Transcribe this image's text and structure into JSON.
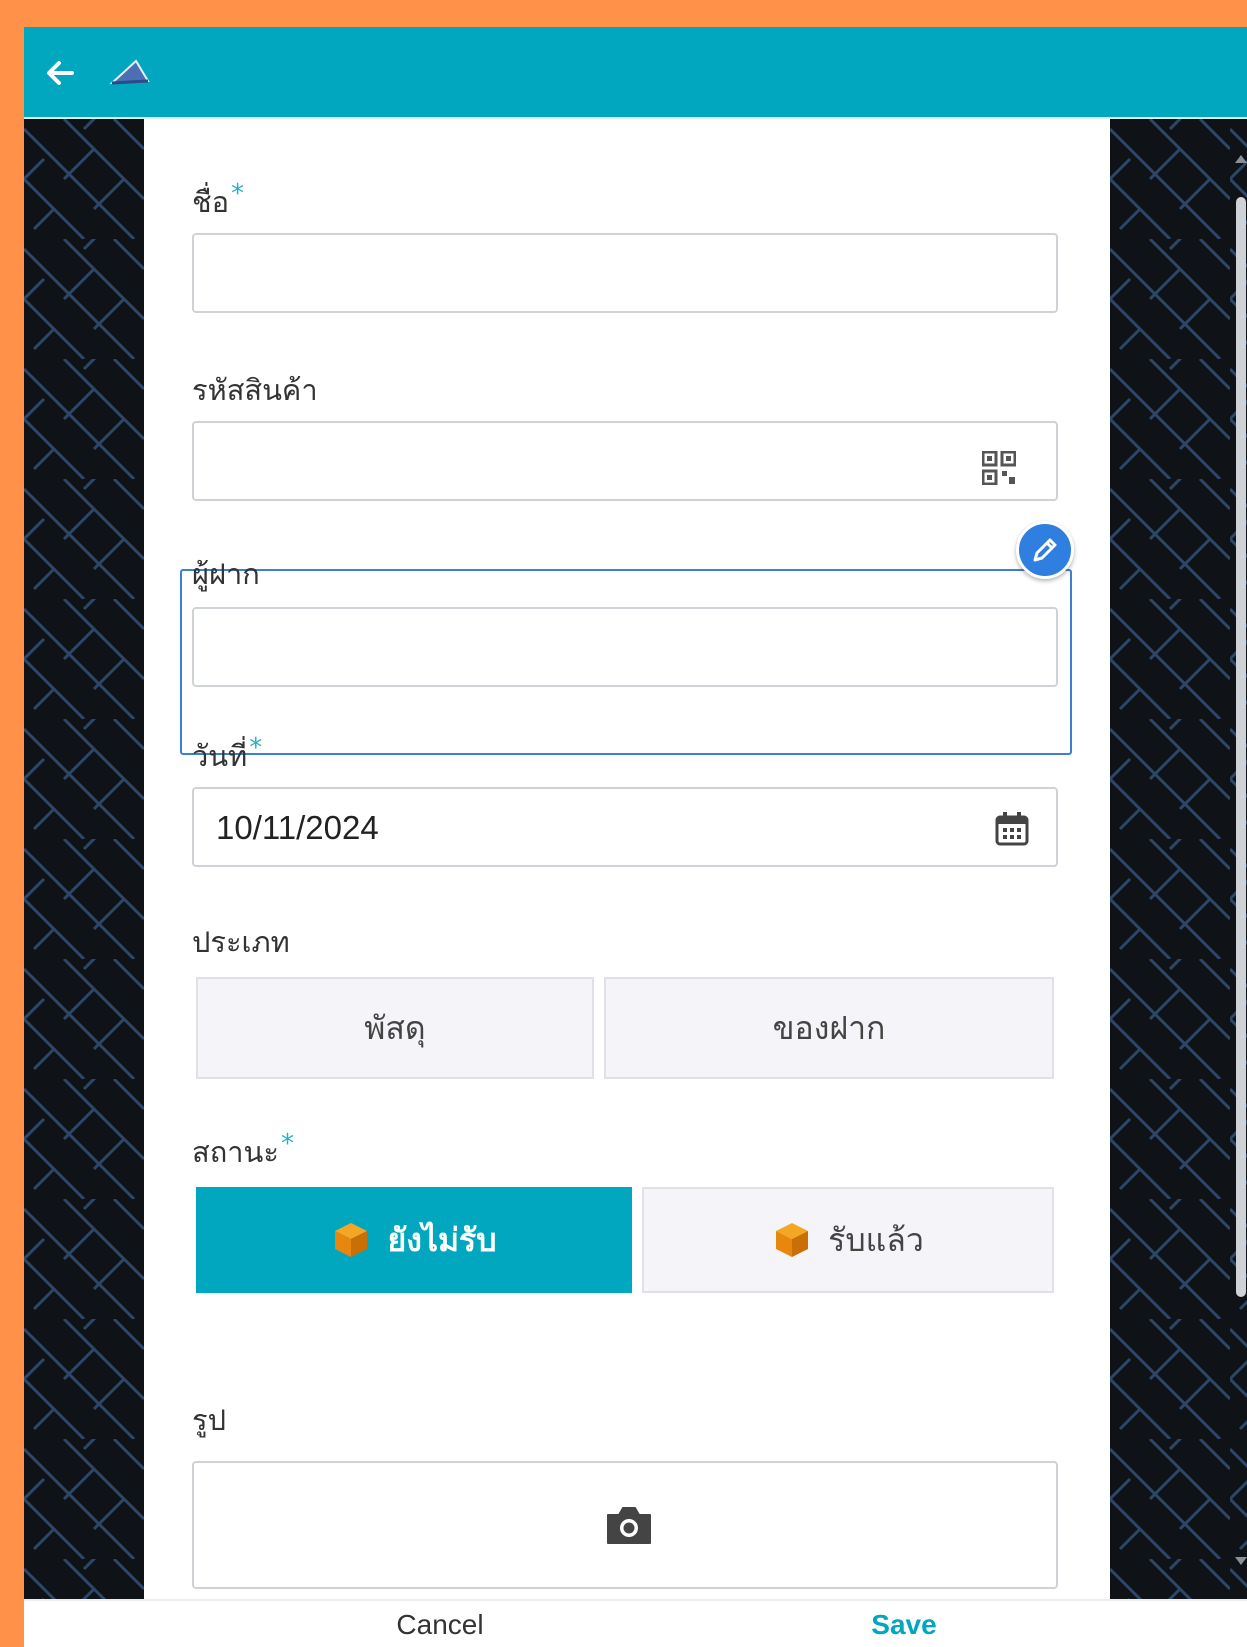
{
  "colors": {
    "brand": "#00A7BF",
    "background": "#FF9248",
    "accent_blue": "#2F7FE0",
    "package_icon": "#E8870D"
  },
  "header": {
    "back_icon": "arrow-left-icon",
    "logo_icon": "logo-icon"
  },
  "form": {
    "name": {
      "label": "ชื่อ",
      "required_mark": "*",
      "value": ""
    },
    "product_code": {
      "label": "รหัสสินค้า",
      "value": "",
      "icon": "qr-code-icon"
    },
    "depositor": {
      "label": "ผู้ฝาก",
      "value": ""
    },
    "date": {
      "label": "วันที่",
      "required_mark": "*",
      "value": "10/11/2024",
      "icon": "calendar-icon"
    },
    "type": {
      "label": "ประเภท",
      "options": [
        "พัสดุ",
        "ของฝาก"
      ]
    },
    "status": {
      "label": "สถานะ",
      "required_mark": "*",
      "options": [
        "ยังไม่รับ",
        "รับแล้ว"
      ],
      "selected": "ยังไม่รับ",
      "option_icon": "package-icon"
    },
    "photo": {
      "label": "รูป",
      "icon": "camera-icon"
    }
  },
  "footer": {
    "cancel_label": "Cancel",
    "save_label": "Save"
  }
}
